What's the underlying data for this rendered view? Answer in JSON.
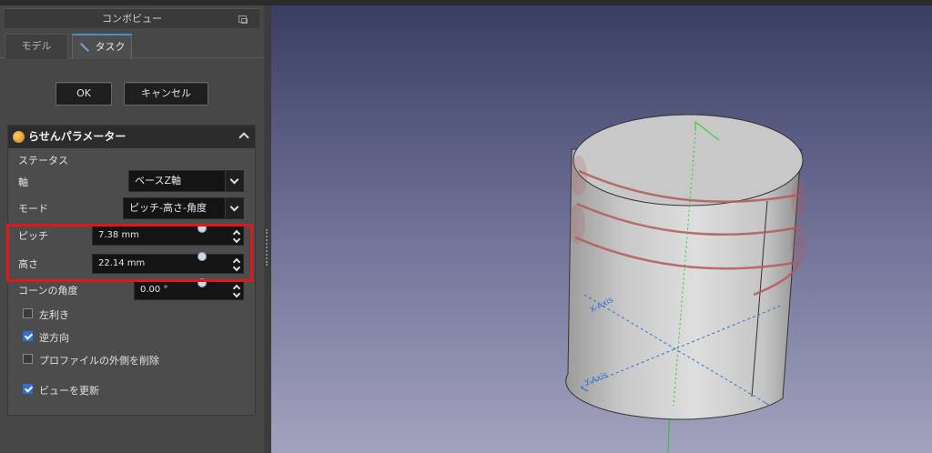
{
  "panel": {
    "title": "コンボビュー",
    "tabs": [
      {
        "label": "モデル"
      },
      {
        "label": "タスク"
      }
    ]
  },
  "buttons": {
    "ok": "OK",
    "cancel": "キャンセル"
  },
  "helix_parameters": {
    "title": "らせんパラメーター",
    "status_label": "ステータス",
    "axis": {
      "label": "軸",
      "value": "ベースZ軸"
    },
    "mode": {
      "label": "モード",
      "value": "ピッチ-高さ-角度"
    },
    "pitch": {
      "label": "ピッチ",
      "value": "7.38 mm"
    },
    "height": {
      "label": "高さ",
      "value": "22.14 mm"
    },
    "cone_angle": {
      "label": "コーンの角度",
      "value": "0.00 °"
    },
    "checkboxes": {
      "left_handed": {
        "label": "左利き",
        "checked": false
      },
      "reversed": {
        "label": "逆方向",
        "checked": true
      },
      "remove_outside": {
        "label": "プロファイルの外側を削除",
        "checked": false
      },
      "update_view": {
        "label": "ビューを更新",
        "checked": true
      }
    }
  },
  "view3d": {
    "axis_labels": {
      "x": "X-Axis",
      "y": "Y-Axis"
    },
    "colors": {
      "highlight": "#e01818",
      "helix": "#c46a6a",
      "z_axis": "#22cc22",
      "xy_axes": "#2f6fd6"
    }
  }
}
